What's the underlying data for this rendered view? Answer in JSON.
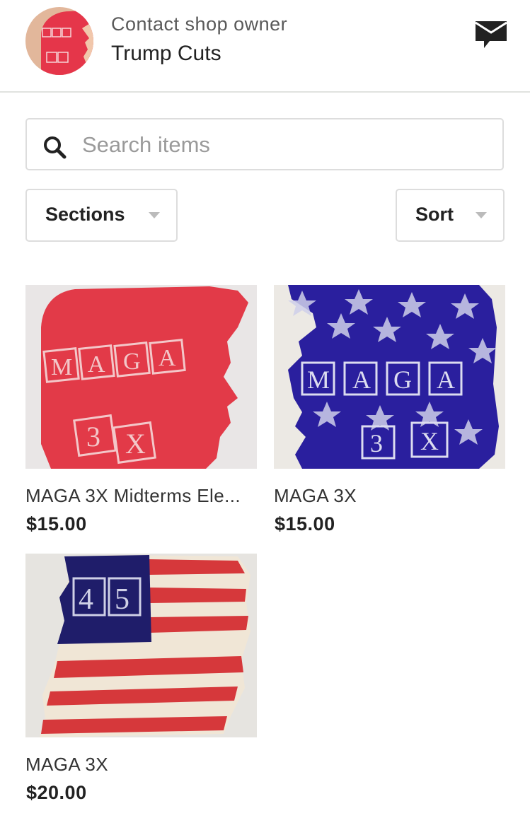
{
  "header": {
    "contact_label": "Contact shop owner",
    "shop_name": "Trump Cuts",
    "avatar_text": "MAGA 3X",
    "message_icon": "message-envelope-icon"
  },
  "search": {
    "placeholder": "Search items",
    "value": "",
    "icon": "search-icon"
  },
  "filters": {
    "sections_label": "Sections",
    "sort_label": "Sort"
  },
  "colors": {
    "red": "#d9353f",
    "navy": "#2a1f9e",
    "divider": "#e1e3df"
  },
  "items": [
    {
      "title": "MAGA 3X Midterms Ele...",
      "price": "$15.00",
      "art_text": "MAGA 3X"
    },
    {
      "title": "MAGA 3X",
      "price": "$15.00",
      "art_text": "MAGA 3X"
    },
    {
      "title": "MAGA 3X",
      "price": "$20.00",
      "art_text": "45"
    }
  ]
}
